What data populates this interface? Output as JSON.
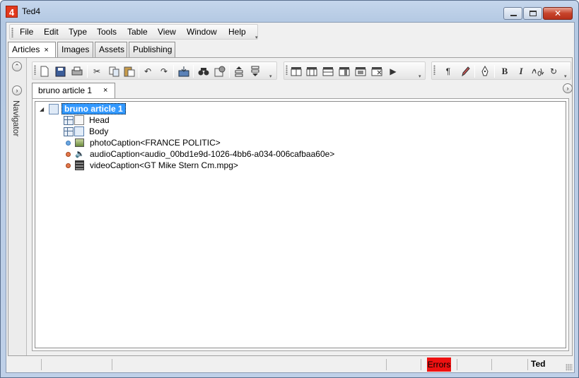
{
  "window": {
    "title": "Ted4",
    "app_icon_text": "4"
  },
  "menu": {
    "items": [
      "File",
      "Edit",
      "Type",
      "Tools",
      "Table",
      "View",
      "Window",
      "Help"
    ]
  },
  "top_tabs": [
    {
      "label": "Articles",
      "close": "×",
      "active": true
    },
    {
      "label": "Images"
    },
    {
      "label": "Assets"
    },
    {
      "label": "Publishing"
    }
  ],
  "side_panel": {
    "label": "Navigator"
  },
  "toolbar": {
    "icons": [
      "new-document-icon",
      "save-icon",
      "print-icon",
      "cut-icon",
      "copy-icon",
      "paste-icon",
      "undo-icon",
      "redo-icon",
      "import-icon",
      "find-icon",
      "properties-icon",
      "move-up-icon",
      "move-down-icon",
      "table-icon",
      "insert-row-above-icon",
      "insert-row-below-icon",
      "insert-column-icon",
      "merge-cells-icon",
      "delete-table-icon",
      "play-icon",
      "pilcrow-icon",
      "pencil-icon",
      "pen-icon",
      "bold-icon",
      "italic-icon",
      "spellcheck-icon",
      "refresh-icon"
    ],
    "glyphs": {
      "pilcrow": "¶",
      "bold": "B",
      "italic": "I",
      "play": "▶"
    }
  },
  "document_tab": {
    "label": "bruno article 1",
    "close": "×"
  },
  "tree": {
    "root": {
      "label": "bruno article 1",
      "expander": "◢"
    },
    "children": [
      {
        "label": "Head",
        "icon": "grid-page-icon"
      },
      {
        "label": "Body",
        "icon": "grid-page-blue-icon"
      },
      {
        "label": "photoCaption<FRANCE POLITIC>",
        "status": "blue",
        "icon": "photo-icon"
      },
      {
        "label": "audioCaption<audio_00bd1e9d-1026-4bb6-a034-006cafbaa60e>",
        "status": "orange",
        "icon": "speaker-icon"
      },
      {
        "label": "videoCaption<GT Mike Stern Cm.mpg>",
        "status": "orange",
        "icon": "film-icon"
      }
    ]
  },
  "status_bar": {
    "errors_label": "Errors",
    "user": "Ted",
    "errors_color": "#ee1111"
  }
}
